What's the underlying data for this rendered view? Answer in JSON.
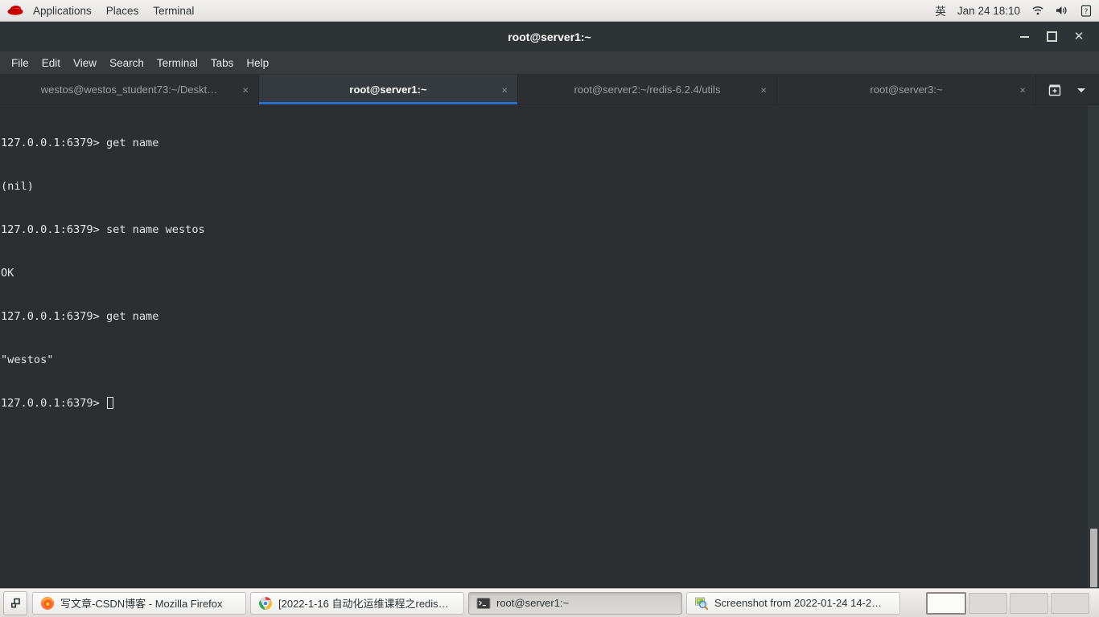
{
  "top_panel": {
    "logo": "redhat-logo",
    "menus": [
      {
        "label": "Applications"
      },
      {
        "label": "Places"
      },
      {
        "label": "Terminal"
      }
    ],
    "ime": "英",
    "clock": "Jan 24  18:10",
    "tray": [
      {
        "icon": "wifi-icon"
      },
      {
        "icon": "volume-icon"
      },
      {
        "icon": "help-icon"
      }
    ]
  },
  "window": {
    "title": "root@server1:~",
    "controls": {
      "minimize": "minimize-button",
      "maximize": "maximize-button",
      "close": "close-button"
    },
    "menu_bar": [
      {
        "label": "File"
      },
      {
        "label": "Edit"
      },
      {
        "label": "View"
      },
      {
        "label": "Search"
      },
      {
        "label": "Terminal"
      },
      {
        "label": "Tabs"
      },
      {
        "label": "Help"
      }
    ],
    "tabs": [
      {
        "label": "westos@westos_student73:~/Deskt…",
        "active": false,
        "close": "×"
      },
      {
        "label": "root@server1:~",
        "active": true,
        "close": "×"
      },
      {
        "label": "root@server2:~/redis-6.2.4/utils",
        "active": false,
        "close": "×"
      },
      {
        "label": "root@server3:~",
        "active": false,
        "close": "×"
      }
    ],
    "tab_tools": {
      "new_tab": "new-tab-icon",
      "tab_list": "chevron-down-icon"
    },
    "accent_color": "#2a6fc9",
    "background_color": "#2b2f32"
  },
  "terminal": {
    "lines": [
      "127.0.0.1:6379> get name",
      "(nil)",
      "127.0.0.1:6379> set name westos",
      "OK",
      "127.0.0.1:6379> get name",
      "\"westos\""
    ],
    "prompt": "127.0.0.1:6379> ",
    "cursor": "block-cursor"
  },
  "taskbar": {
    "launcher": "window-list-icon",
    "items": [
      {
        "label": "写文章-CSDN博客 - Mozilla Firefox",
        "icon": "firefox-icon",
        "active": false
      },
      {
        "label": "[2022-1-16 自动化运维课程之redis…",
        "icon": "chrome-icon",
        "active": false
      },
      {
        "label": "root@server1:~",
        "icon": "terminal-icon",
        "active": true
      },
      {
        "label": "Screenshot from 2022-01-24 14-2…",
        "icon": "screenshot-icon",
        "active": false
      }
    ],
    "workspaces": [
      {
        "active": true
      },
      {
        "active": false
      },
      {
        "active": false
      },
      {
        "active": false
      }
    ]
  }
}
